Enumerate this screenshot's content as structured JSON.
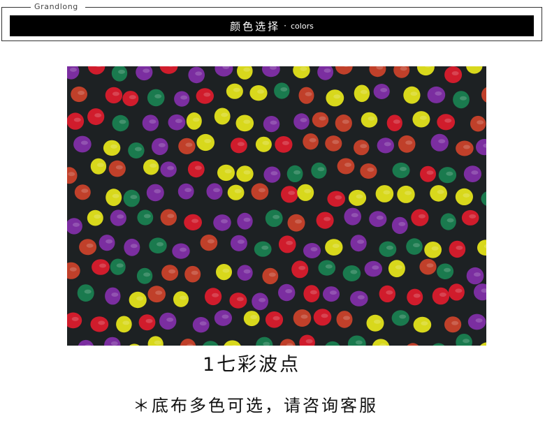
{
  "header": {
    "brand": "Grandlong",
    "title_cn": "颜色选择",
    "title_sep": "·",
    "title_en": "colors"
  },
  "product": {
    "color_label": "1七彩波点",
    "note": "＊底布多色可选，请咨询客服"
  },
  "fabric": {
    "background_color": "#1d2123",
    "dot_colors": [
      "#7b2ea0",
      "#d8d81c",
      "#c0402a",
      "#1a7a4e",
      "#d01c2c"
    ]
  }
}
